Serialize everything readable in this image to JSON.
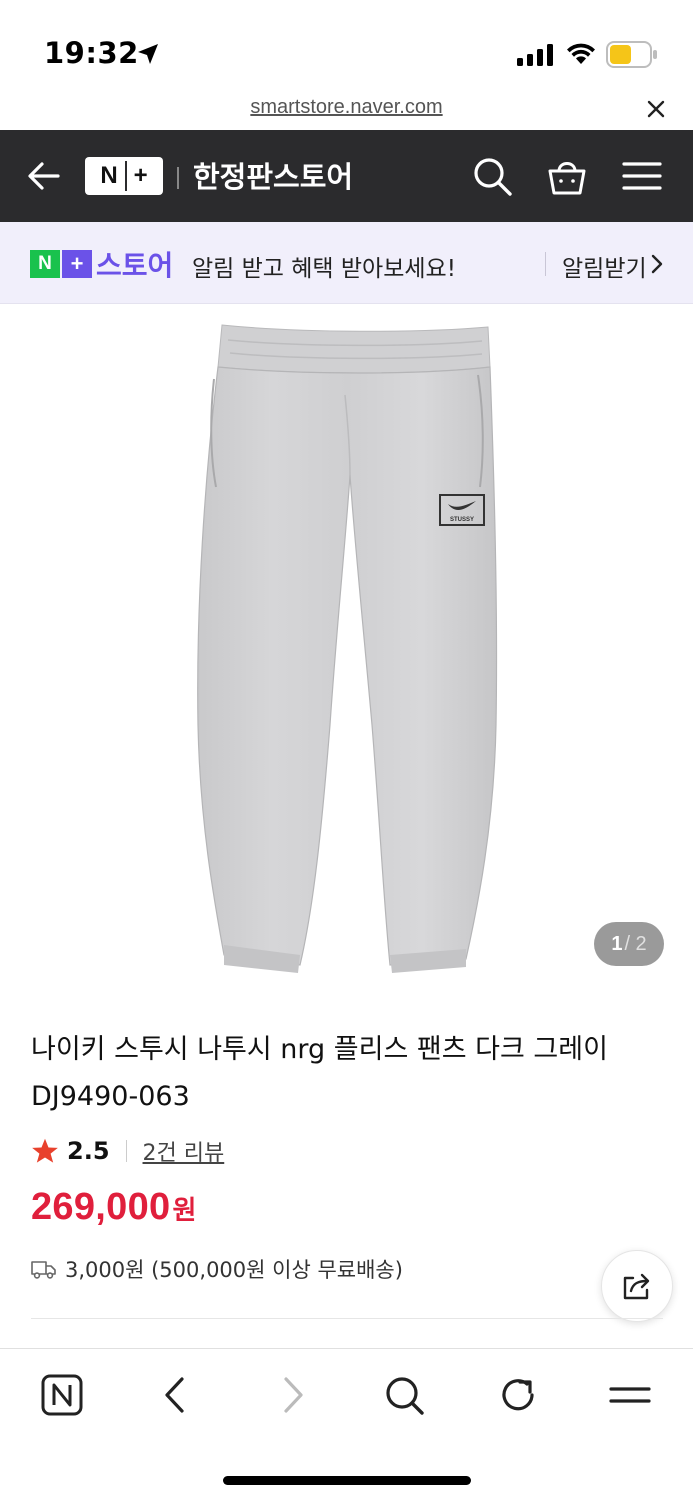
{
  "status_bar": {
    "time": "19:32"
  },
  "browser": {
    "url": "smartstore.naver.com"
  },
  "header": {
    "logo_n": "N",
    "logo_plus": "+",
    "store_name": "한정판스토어"
  },
  "alert_banner": {
    "badge_n": "N",
    "badge_plus": "+",
    "store_word": "스토어",
    "message": "알림 받고 혜택 받아보세요!",
    "button_label": "알림받기"
  },
  "image_pager": {
    "current": "1",
    "total": "/ 2"
  },
  "product": {
    "title": "나이키 스투시 나투시 nrg 플리스 팬츠 다크 그레이 DJ9490-063",
    "rating": "2.5",
    "review_link": "2건 리뷰",
    "price": "269,000",
    "price_unit": "원",
    "shipping": "3,000원 (500,000원 이상 무료배송)",
    "logo_text": "STUSSY"
  },
  "colors": {
    "accent_red": "#e01f3c",
    "naver_green": "#19c24d",
    "naver_purple": "#6b52e8",
    "header_bg": "#2b2b2d"
  }
}
